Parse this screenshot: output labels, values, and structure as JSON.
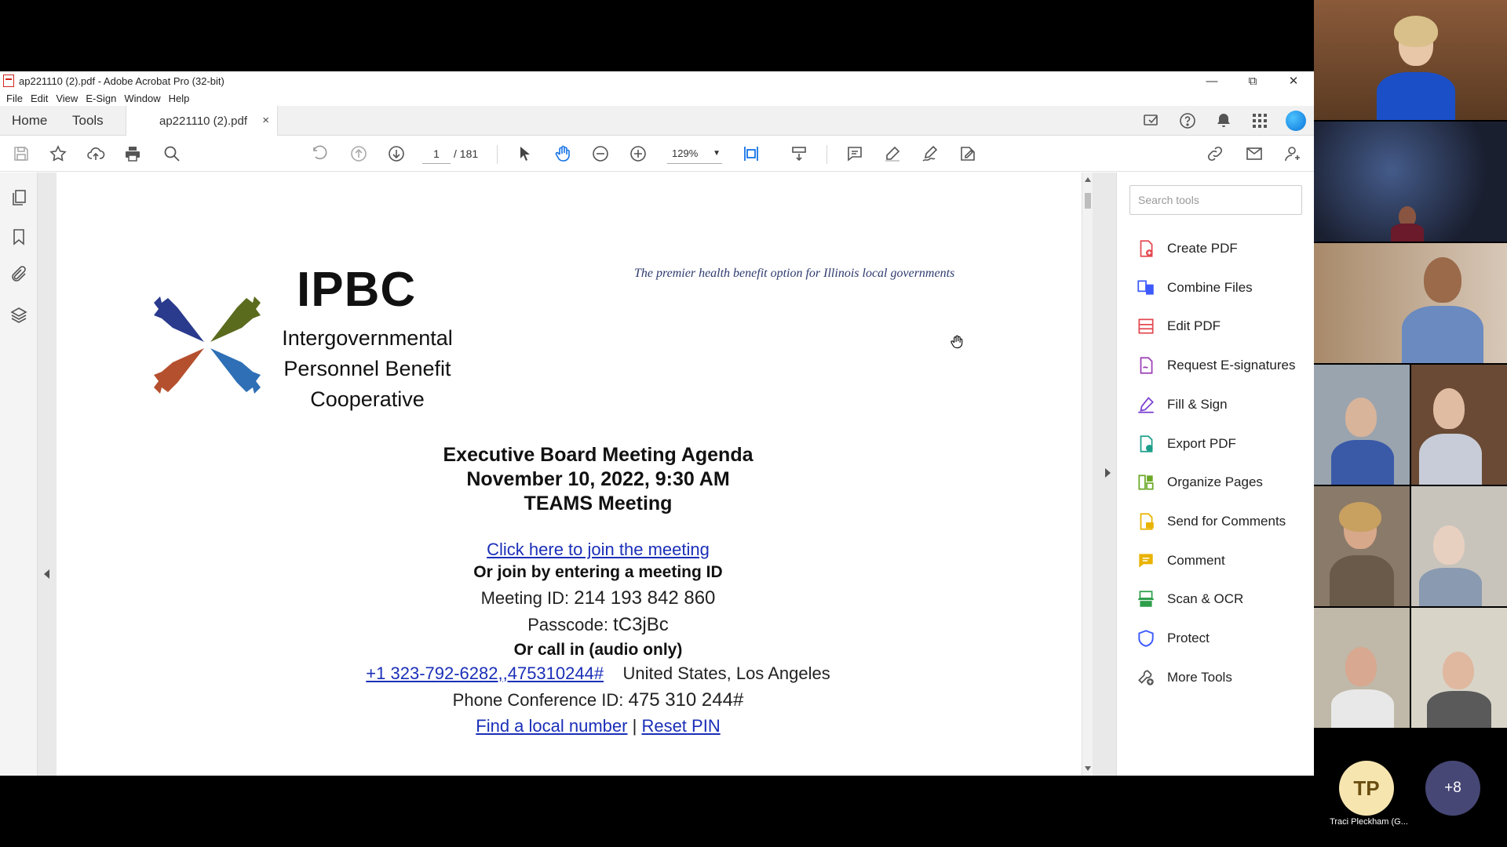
{
  "window": {
    "title": "ap221110 (2).pdf - Adobe Acrobat Pro (32-bit)",
    "menu": [
      "File",
      "Edit",
      "View",
      "E-Sign",
      "Window",
      "Help"
    ]
  },
  "tabs": {
    "home": "Home",
    "tools": "Tools",
    "document": "ap221110 (2).pdf",
    "close": "×"
  },
  "toolbar": {
    "current_page": "1",
    "page_total": "/ 181",
    "zoom": "129%"
  },
  "document": {
    "logo_title": "IPBC",
    "org_name": [
      "Intergovernmental",
      "Personnel Benefit",
      "Cooperative"
    ],
    "tagline": "The premier health benefit option for Illinois local governments",
    "agenda": [
      "Executive Board Meeting Agenda",
      "November 10, 2022, 9:30 AM",
      "TEAMS Meeting"
    ],
    "join_link": "Click here to join the meeting",
    "or_join": "Or join by entering a meeting ID",
    "meeting_id_label": "Meeting ID:",
    "meeting_id": "214 193 842 860",
    "passcode_label": "Passcode:",
    "passcode": "tC3jBc",
    "call_in": "Or call in (audio only)",
    "phone_link": "+1 323-792-6282,,475310244#",
    "phone_location": "United States, Los Angeles",
    "conf_id_label": "Phone Conference ID:",
    "conf_id": "475 310 244#",
    "local_number_link": "Find a local number",
    "separator": "|",
    "reset_pin_link": "Reset PIN"
  },
  "tools_panel": {
    "search_placeholder": "Search tools",
    "items": [
      {
        "label": "Create PDF",
        "icon": "create-pdf-icon",
        "color": "#e34850"
      },
      {
        "label": "Combine Files",
        "icon": "combine-files-icon",
        "color": "#3d5afe"
      },
      {
        "label": "Edit PDF",
        "icon": "edit-pdf-icon",
        "color": "#e34850"
      },
      {
        "label": "Request E-signatures",
        "icon": "request-esign-icon",
        "color": "#9b3fb6"
      },
      {
        "label": "Fill & Sign",
        "icon": "fill-sign-icon",
        "color": "#7a3fd0"
      },
      {
        "label": "Export PDF",
        "icon": "export-pdf-icon",
        "color": "#1e9e8a"
      },
      {
        "label": "Organize Pages",
        "icon": "organize-pages-icon",
        "color": "#6aa825"
      },
      {
        "label": "Send for Comments",
        "icon": "send-comments-icon",
        "color": "#e9b300"
      },
      {
        "label": "Comment",
        "icon": "comment-icon",
        "color": "#e9b300"
      },
      {
        "label": "Scan & OCR",
        "icon": "scan-ocr-icon",
        "color": "#2e9e4b"
      },
      {
        "label": "Protect",
        "icon": "protect-icon",
        "color": "#3d5afe"
      },
      {
        "label": "More Tools",
        "icon": "more-tools-icon",
        "color": "#555555"
      }
    ]
  },
  "meeting": {
    "avatar_initials": "TP",
    "avatar_name": "Traci Pleckham (G...",
    "more_count": "+8"
  }
}
